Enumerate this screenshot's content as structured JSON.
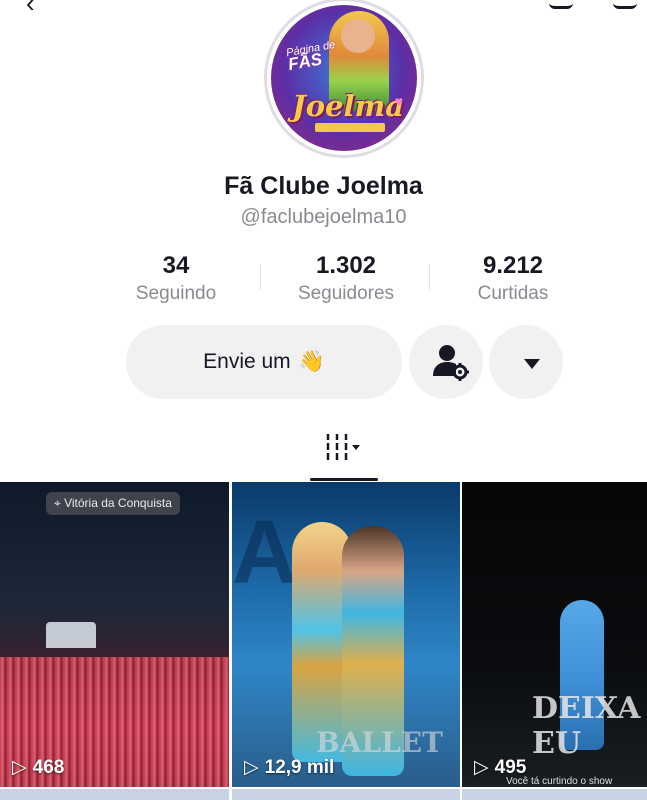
{
  "profile": {
    "display_name": "Fã Clube Joelma",
    "username": "@faclubejoelma10",
    "avatar": {
      "badge_line1": "Página de",
      "badge_line2": "FÃS",
      "logo_text": "Joelma"
    }
  },
  "stats": [
    {
      "value": "34",
      "label": "Seguindo"
    },
    {
      "value": "1.302",
      "label": "Seguidores"
    },
    {
      "value": "9.212",
      "label": "Curtidas"
    }
  ],
  "actions": {
    "message_label": "Envie um",
    "message_emoji": "👋",
    "dropdown_glyph": "▼"
  },
  "tabs": {
    "grid_glyph": "|||▾"
  },
  "videos": [
    {
      "views": "468",
      "location": "Vitória da Conquista"
    },
    {
      "views": "12,9 mil",
      "overlay": "BALLET"
    },
    {
      "views": "495",
      "overlay": "DEIXA EU",
      "caption": "Você tá curtindo o show"
    }
  ],
  "colors": {
    "text_primary": "#161823",
    "text_secondary": "#8a8b91",
    "button_bg": "#f1f1f2"
  }
}
